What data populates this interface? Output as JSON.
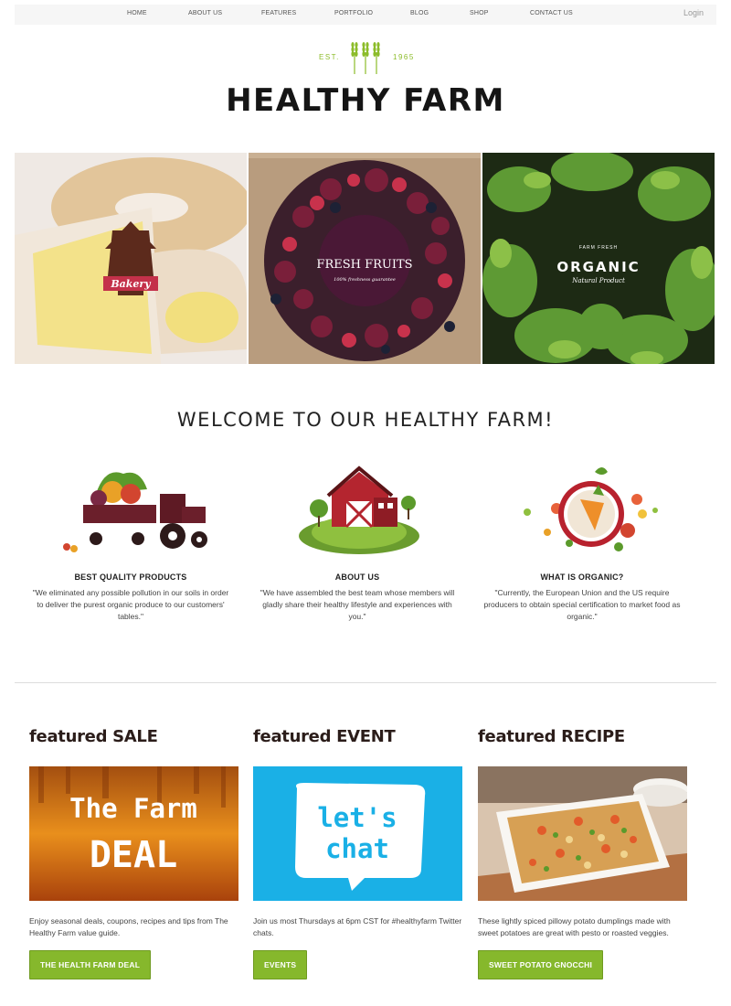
{
  "nav": {
    "items": [
      "HOME",
      "ABOUT US",
      "FEATURES",
      "PORTFOLIO",
      "BLOG",
      "SHOP",
      "CONTACT US"
    ],
    "login": "Login"
  },
  "logo": {
    "est_left": "EST.",
    "est_right": "1965",
    "title": "HEALTHY FARM",
    "icon": "wheat-icon",
    "accent": "#8cbc2a"
  },
  "banner": {
    "bakery_label": "Bakery",
    "fruits_label": "FRESH FRUITS",
    "fruits_sub": "100% freshness guarantee",
    "organic_top": "FARM FRESH",
    "organic_label": "ORGANIC",
    "organic_sub": "Natural Product"
  },
  "welcome": {
    "heading": "WELCOME TO OUR HEALTHY FARM!",
    "features": [
      {
        "title": "BEST QUALITY PRODUCTS",
        "text": "\"We eliminated any possible pollution in our soils in order to deliver the purest organic produce to our customers' tables.\"",
        "icon": "tractor-icon"
      },
      {
        "title": "ABOUT US",
        "text": "\"We have assembled the best team whose members will gladly share their healthy lifestyle and experiences with you.\"",
        "icon": "barn-icon"
      },
      {
        "title": "WHAT IS ORGANIC?",
        "text": "\"Currently, the European Union and the US require producers to obtain special certification to market food as organic.\"",
        "icon": "plate-icon"
      }
    ]
  },
  "featured": [
    {
      "heading": "featured SALE",
      "image_line1": "The Farm",
      "image_line2": "DEAL",
      "text": "Enjoy seasonal deals, coupons, recipes and tips from The Healthy Farm value guide.",
      "button": "THE HEALTH FARM DEAL"
    },
    {
      "heading": "featured EVENT",
      "image_line1": "let's",
      "image_line2": "chat",
      "text": "Join us most Thursdays at 6pm CST for #healthyfarm Twitter chats.",
      "button": "EVENTS"
    },
    {
      "heading": "featured RECIPE",
      "text": "These lightly spiced pillowy potato dumplings made with sweet potatoes are great with pesto or roasted veggies.",
      "button": "SWEET POTATO GNOCCHI"
    }
  ],
  "colors": {
    "button": "#86b82c",
    "brand_text": "#151515",
    "event_bg": "#1ab0e6"
  }
}
